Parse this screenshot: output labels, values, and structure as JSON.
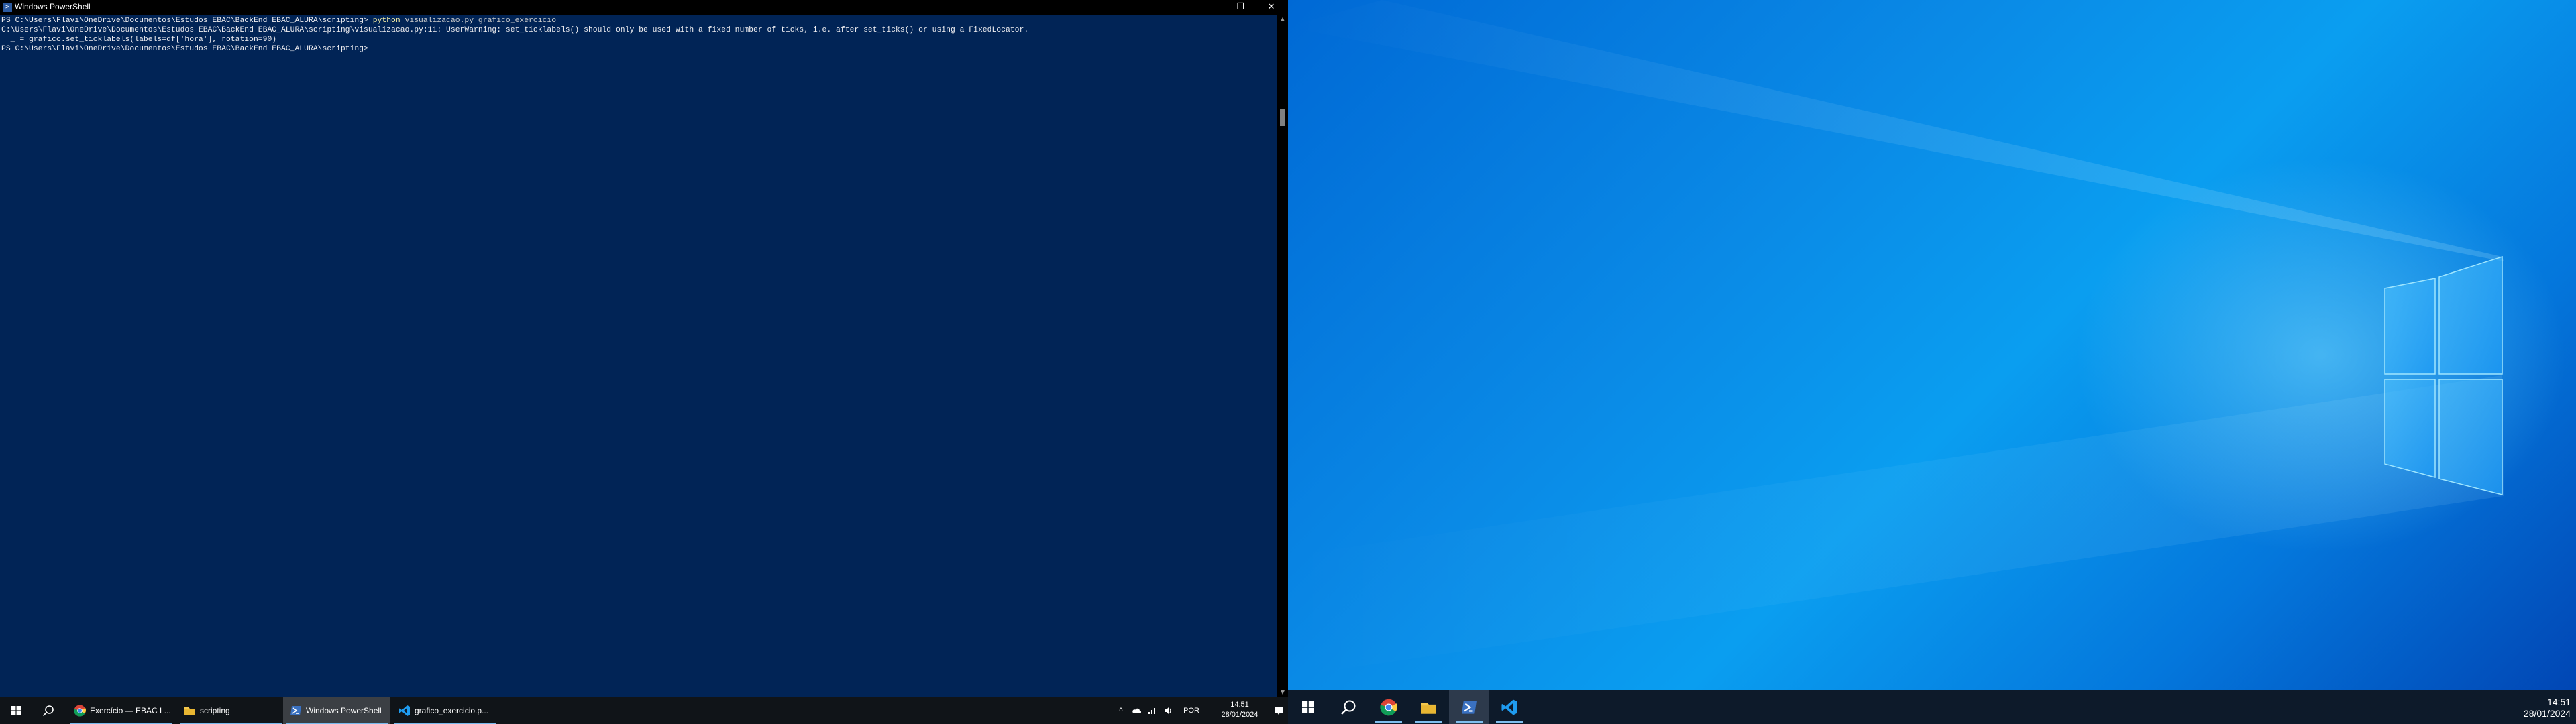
{
  "powershell": {
    "title": "Windows PowerShell",
    "window_controls": {
      "minimize": "—",
      "maximize": "❐",
      "close": "✕"
    },
    "lines": {
      "l1_prompt": "PS C:\\Users\\Flavi\\OneDrive\\Documentos\\Estudos EBAC\\BackEnd EBAC_ALURA\\scripting> ",
      "l1_cmd": "python",
      "l1_args": " visualizacao.py grafico_exercicio",
      "l2": "C:\\Users\\Flavi\\OneDrive\\Documentos\\Estudos EBAC\\BackEnd EBAC_ALURA\\scripting\\visualizacao.py:11: UserWarning: set_ticklabels() should only be used with a fixed number of ticks, i.e. after set_ticks() or using a FixedLocator.",
      "l3": "  _ = grafico.set_ticklabels(labels=df['hora'], rotation=90)",
      "l4": "PS C:\\Users\\Flavi\\OneDrive\\Documentos\\Estudos EBAC\\BackEnd EBAC_ALURA\\scripting> "
    }
  },
  "taskbar_left": {
    "apps": [
      {
        "label": "Exercício — EBAC L...",
        "icon": "chrome-icon"
      },
      {
        "label": "scripting",
        "icon": "folder-icon"
      },
      {
        "label": "Windows PowerShell",
        "icon": "powershell-icon",
        "active": true
      },
      {
        "label": "grafico_exercicio.p...",
        "icon": "vscode-icon"
      }
    ],
    "tray": {
      "language": "POR",
      "time": "14:51",
      "date": "28/01/2024"
    }
  },
  "taskbar_right": {
    "time": "14:51",
    "date": "28/01/2024"
  },
  "colors": {
    "console_bg": "#012456",
    "taskbar_bg": "#101418",
    "accent": "#76b9ed"
  }
}
